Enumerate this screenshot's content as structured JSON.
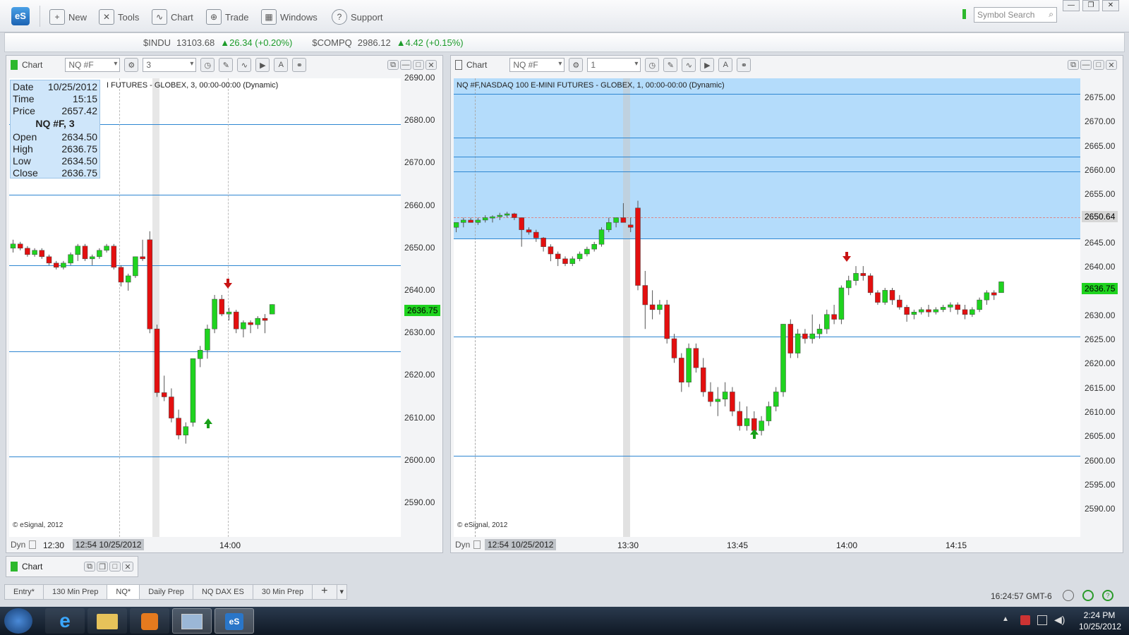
{
  "toolbar": {
    "logo": "eS",
    "buttons": [
      {
        "label": "New",
        "icon": "new-icon"
      },
      {
        "label": "Tools",
        "icon": "tools-icon"
      },
      {
        "label": "Chart",
        "icon": "chart-icon"
      },
      {
        "label": "Trade",
        "icon": "trade-icon"
      },
      {
        "label": "Windows",
        "icon": "windows-icon"
      },
      {
        "label": "Support",
        "icon": "support-icon"
      }
    ],
    "search_placeholder": "Symbol Search"
  },
  "ticker": {
    "items": [
      {
        "symbol": "$INDU",
        "value": "13103.68",
        "change": "26.34 (+0.20%)"
      },
      {
        "symbol": "$COMPQ",
        "value": "2986.12",
        "change": "4.42 (+0.15%)"
      }
    ]
  },
  "left_chart": {
    "title": "Chart",
    "symbol": "NQ #F",
    "interval": "3",
    "header_text": "NASDAQ 100 E-MINI FUTURES - GLOBEX, 3, 00:00-00:00 (Dynamic)",
    "header_visible": "I FUTURES - GLOBEX, 3, 00:00-00:00 (Dynamic)",
    "info": {
      "date_label": "Date",
      "date": "10/25/2012",
      "time_label": "Time",
      "time": "15:15",
      "price_label": "Price",
      "price": "2657.42",
      "series": "NQ #F, 3",
      "open_label": "Open",
      "open": "2634.50",
      "high_label": "High",
      "high": "2636.75",
      "low_label": "Low",
      "low": "2634.50",
      "close_label": "Close",
      "close": "2636.75"
    },
    "y_ticks": [
      "2690.00",
      "2680.00",
      "2670.00",
      "2660.00",
      "2650.00",
      "2640.00",
      "2630.00",
      "2620.00",
      "2610.00",
      "2600.00",
      "2590.00"
    ],
    "last_price": "2636.75",
    "copyright": "© eSignal, 2012",
    "footer": {
      "dyn": "Dyn",
      "time_start": "12:30",
      "cursor_time": "12:54 10/25/2012",
      "x_tick": "14:00"
    }
  },
  "right_chart": {
    "title": "Chart",
    "symbol": "NQ #F",
    "interval": "1",
    "header_text": "NQ #F,NASDAQ 100 E-MINI FUTURES - GLOBEX, 1, 00:00-00:00 (Dynamic)",
    "y_ticks": [
      "2675.00",
      "2670.00",
      "2665.00",
      "2660.00",
      "2655.00",
      "2650.00",
      "2645.00",
      "2640.00",
      "2635.00",
      "2630.00",
      "2625.00",
      "2620.00",
      "2615.00",
      "2610.00",
      "2605.00",
      "2600.00",
      "2595.00",
      "2590.00"
    ],
    "cursor_price": "2650.64",
    "last_price": "2636.75",
    "copyright": "© eSignal, 2012",
    "footer": {
      "dyn": "Dyn",
      "cursor_time": "12:54 10/25/2012",
      "x_ticks": [
        "13:30",
        "13:45",
        "14:00",
        "14:15"
      ]
    }
  },
  "minimized_chart": {
    "title": "Chart"
  },
  "tabs": [
    "Entry*",
    "130 Min Prep",
    "NQ*",
    "Daily Prep",
    "NQ DAX ES",
    "30 Min Prep"
  ],
  "active_tab": "NQ*",
  "status": {
    "clock": "16:24:57 GMT-6"
  },
  "taskbar": {
    "time": "2:24 PM",
    "date": "10/25/2012"
  },
  "colors": {
    "up": "#1fd31f",
    "down": "#e30f0f",
    "level_line": "#2e86d1",
    "highlight": "#b4dcfb"
  }
}
